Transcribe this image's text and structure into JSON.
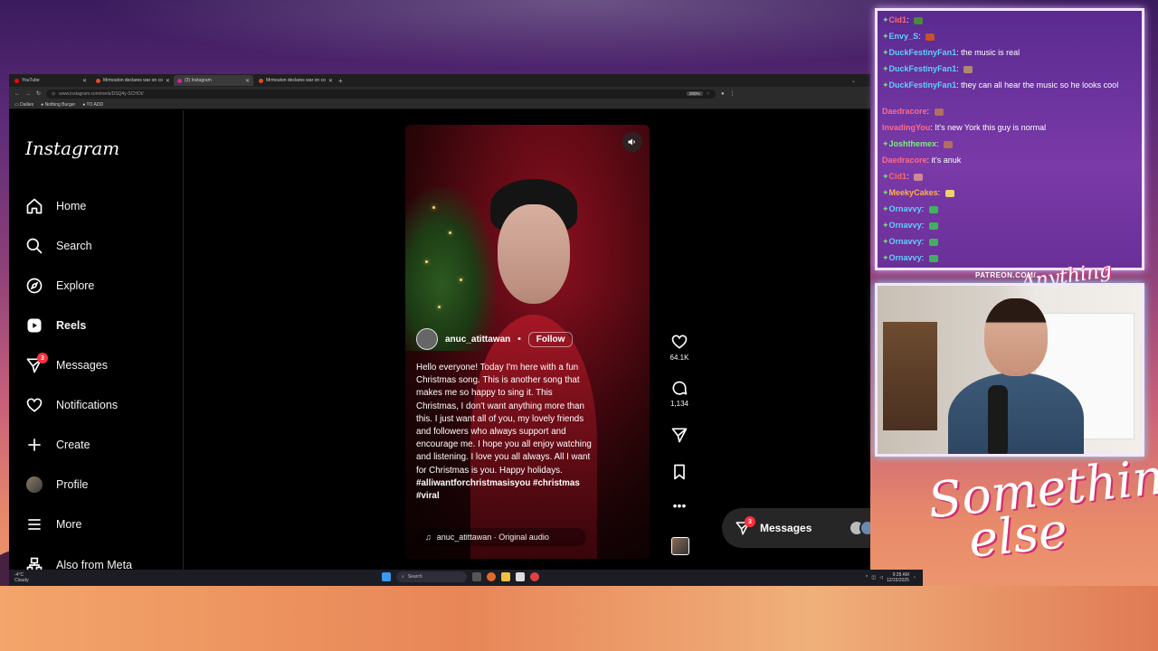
{
  "browser": {
    "tabs": [
      {
        "label": "YouTube",
        "color": "#ff0000",
        "active": false
      },
      {
        "label": "Mrmouton declares war on co",
        "color": "#e04a2a",
        "active": false
      },
      {
        "label": "(3) Instagram",
        "color": "#d6249f",
        "active": true
      },
      {
        "label": "Mrmouton declares war on co",
        "color": "#e04a2a",
        "active": false
      }
    ],
    "url": "www.instagram.com/reels/DSQ4y-SCHOI/",
    "zoom": "200%",
    "bookmarks": [
      "Dailies",
      "Nothing Burger",
      "TO ADD"
    ]
  },
  "instagram": {
    "logo": "Instagram",
    "nav": [
      {
        "label": "Home",
        "icon": "home-icon"
      },
      {
        "label": "Search",
        "icon": "search-icon"
      },
      {
        "label": "Explore",
        "icon": "compass-icon"
      },
      {
        "label": "Reels",
        "icon": "reels-icon"
      },
      {
        "label": "Messages",
        "icon": "messenger-icon",
        "badge": "3"
      },
      {
        "label": "Notifications",
        "icon": "heart-icon"
      },
      {
        "label": "Create",
        "icon": "plus-icon"
      },
      {
        "label": "Profile",
        "icon": "avatar"
      },
      {
        "label": "More",
        "icon": "menu-icon"
      },
      {
        "label": "Also from Meta",
        "icon": "meta-icon"
      }
    ],
    "reel": {
      "username": "anuc_atittawan",
      "verified_dot": "•",
      "follow": "Follow",
      "caption": "Hello everyone! Today I'm here with a fun Christmas song. This is another song that makes me so happy to sing it. This Christmas, I don't want anything more than this. I just want all of you, my lovely friends and followers who always support and encourage me. I hope you all enjoy watching and listening. I love you all always. All I want for Christmas is you. Happy holidays.",
      "hashtags": "#alliwantforchristmasisyou #christmas #viral",
      "audio": "anuc_atittawan · Original audio",
      "likes": "64.1K",
      "comments": "1,134"
    },
    "messages_pill": {
      "label": "Messages",
      "badge": "3"
    }
  },
  "taskbar": {
    "weather_temp": "-4°C",
    "weather_desc": "Cloudy",
    "search": "Search",
    "time": "9:28 AM",
    "date": "12/15/2025"
  },
  "chat": [
    {
      "user": "Cid1",
      "color": "#ff6a6a",
      "star": true,
      "msg": "",
      "emote": "#4a8a3a"
    },
    {
      "user": "Envy_S",
      "color": "#5fd0ff",
      "star": true,
      "msg": "",
      "emote": "#c8502a"
    },
    {
      "user": "DuckFestinyFan1",
      "color": "#5fd0ff",
      "star": true,
      "msg": "the music is real",
      "emote": ""
    },
    {
      "user": "DuckFestinyFan1",
      "color": "#5fd0ff",
      "star": true,
      "msg": "",
      "emote": "#b08870"
    },
    {
      "user": "DuckFestinyFan1",
      "color": "#5fd0ff",
      "star": true,
      "msg": "they can all hear the music so he looks cool",
      "emote": ""
    },
    {
      "user": "Daedracore",
      "color": "#ff6a8a",
      "star": false,
      "msg": "",
      "emote": "#b07060"
    },
    {
      "user": "InvadingYou",
      "color": "#ff6a8a",
      "star": false,
      "msg": "It's new York this guy is normal",
      "emote": ""
    },
    {
      "user": "Joshthemex",
      "color": "#7af07a",
      "star": true,
      "msg": "",
      "emote": "#b07060"
    },
    {
      "user": "Daedracore",
      "color": "#ff6a8a",
      "star": false,
      "msg": "it's anuk",
      "emote": ""
    },
    {
      "user": "Cid1",
      "color": "#ff6a6a",
      "star": true,
      "msg": "",
      "emote": "#d08898"
    },
    {
      "user": "MeekyCakes",
      "color": "#ffb04a",
      "star": true,
      "msg": "",
      "emote": "#f0d070"
    },
    {
      "user": "Ornavvy",
      "color": "#5fd0ff",
      "star": true,
      "msg": "",
      "emote": "#40b060"
    },
    {
      "user": "Ornavvy",
      "color": "#5fd0ff",
      "star": true,
      "msg": "",
      "emote": "#40b060"
    },
    {
      "user": "Ornavvy",
      "color": "#5fd0ff",
      "star": true,
      "msg": "",
      "emote": "#40b060"
    },
    {
      "user": "Ornavvy",
      "color": "#5fd0ff",
      "star": true,
      "msg": "",
      "emote": "#40b060"
    }
  ],
  "overlay": {
    "patreon": "PATREON.COM/",
    "brand_small": "Anything Else?",
    "brand_large_1": "Something",
    "brand_large_2": "else"
  }
}
